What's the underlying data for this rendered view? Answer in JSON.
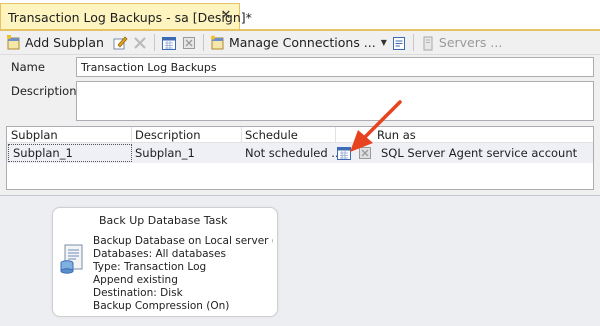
{
  "tab": {
    "title": "Transaction Log Backups - sa [Design]*",
    "close_glyph": "✕"
  },
  "toolbar": {
    "add_subplan": "Add Subplan",
    "manage_connections": "Manage Connections ...",
    "servers": "Servers ...",
    "icons": [
      "add-subplan-icon",
      "subplan-properties-icon",
      "delete-icon",
      "subplan-schedule-icon",
      "remove-schedule-icon",
      "manage-connections-icon",
      "reporting-logging-icon",
      "servers-icon"
    ]
  },
  "form": {
    "name_label": "Name",
    "name_value": "Transaction Log Backups",
    "description_label": "Description",
    "description_value": ""
  },
  "grid": {
    "headers": [
      "Subplan",
      "Description",
      "Schedule",
      "Run as"
    ],
    "rows": [
      {
        "subplan": "Subplan_1",
        "description": "Subplan_1",
        "schedule": "Not scheduled ...",
        "run_as": "SQL Server Agent service account"
      }
    ]
  },
  "task": {
    "title": "Back Up Database Task",
    "lines": [
      "Backup Database on Local server (",
      "Databases: All databases",
      "Type: Transaction Log",
      "Append existing",
      "Destination: Disk",
      "Backup Compression (On)"
    ]
  },
  "colors": {
    "tab_bg": "#fdf4bf",
    "tab_border": "#e5c365",
    "arrow": "#e8431f",
    "surface": "#eceef2"
  }
}
